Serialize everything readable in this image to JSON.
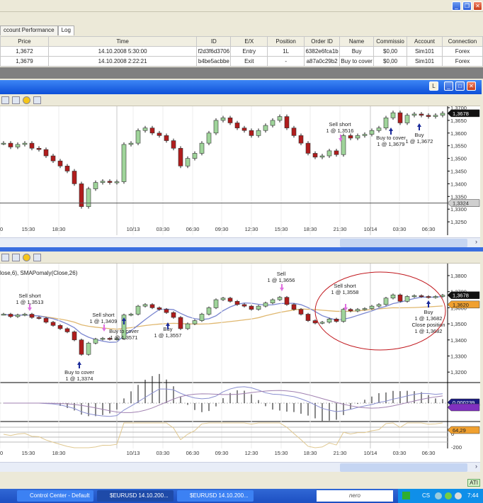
{
  "tabs": [
    "ccount Performance",
    "Log"
  ],
  "executions": {
    "columns": [
      "Price",
      "Time",
      "ID",
      "E/X",
      "Position",
      "Order ID",
      "Name",
      "Commissio",
      "Account",
      "Connection"
    ],
    "rows": [
      [
        "1,3672",
        "14.10.2008 5:30:00",
        "f2d3f6d3706",
        "Entry",
        "1L",
        "6382e6fca1b",
        "Buy",
        "$0,00",
        "Sim101",
        "Forex"
      ],
      [
        "1,3679",
        "14.10.2008 2:22:21",
        "b4be5acbbe",
        "Exit",
        "-",
        "a87a0c29b2",
        "Buy to cover",
        "$0,00",
        "Sim101",
        "Forex"
      ]
    ]
  },
  "chart_window": {
    "time_labels": [
      "30",
      "15:30",
      "18:30",
      "10/13",
      "03:30",
      "06:30",
      "09:30",
      "12:30",
      "15:30",
      "18:30",
      "21:30",
      "10/14",
      "03:30",
      "06:30"
    ],
    "close_prices": [
      1.356,
      1.3545,
      1.3555,
      1.356,
      1.354,
      1.3535,
      1.351,
      1.349,
      1.347,
      1.345,
      1.34,
      1.331,
      1.338,
      1.3405,
      1.341,
      1.3405,
      1.3408,
      1.3555,
      1.356,
      1.361,
      1.362,
      1.36,
      1.359,
      1.357,
      1.354,
      1.347,
      1.35,
      1.352,
      1.356,
      1.36,
      1.365,
      1.366,
      1.364,
      1.362,
      1.361,
      1.359,
      1.361,
      1.363,
      1.365,
      1.3665,
      1.362,
      1.359,
      1.356,
      1.352,
      1.3505,
      1.351,
      1.353,
      1.3515,
      1.359,
      1.358,
      1.359,
      1.3595,
      1.361,
      1.362,
      1.366,
      1.368,
      1.364,
      1.367,
      1.3675,
      1.367,
      1.3665,
      1.367,
      1.3678
    ],
    "top_panel": {
      "price_axis": [
        "1,3700",
        "1,3650",
        "1,3600",
        "1,3550",
        "1,3500",
        "1,3450",
        "1,3400",
        "1,3350",
        "1,3300",
        "1,3250"
      ],
      "last_price": "1,3678",
      "hline_price": "1,3324",
      "annotations": [
        {
          "line1": "Sell short",
          "line2": "1 @ 1,3516",
          "type": "sell"
        },
        {
          "line1": "Buy to cover",
          "line2": "1 @ 1,3679",
          "type": "buy"
        },
        {
          "line1": "Buy",
          "line2": "1 @ 1,3672",
          "type": "buy"
        }
      ]
    },
    "bottom_panel": {
      "indicator_label": "lose,6), SMAPomaly(Close,26)",
      "price_axis": [
        "1,3800",
        "1,3700",
        "1,3600",
        "1,3500",
        "1,3400",
        "1,3300",
        "1,3200"
      ],
      "last_price": "1,3678",
      "sma_value": "1,3620",
      "macd_value": "0,000239",
      "cci_value": "64,29",
      "cci_axis": [
        "0",
        "-200"
      ],
      "annotations": [
        {
          "line1": "Sell short",
          "line2": "1 @ 1,3513",
          "type": "sell"
        },
        {
          "line1": "Sell short",
          "line2": "1 @ 1,3409",
          "type": "sell"
        },
        {
          "line1": "Buy to cover",
          "line2": "1 @ 1,3571",
          "type": "buy"
        },
        {
          "line1": "Buy",
          "line2": "1 @ 1,3557",
          "type": "buy"
        },
        {
          "line1": "Buy to cover",
          "line2": "1 @ 1,3374",
          "type": "buy"
        },
        {
          "line1": "Sell",
          "line2": "1 @ 1,3656",
          "type": "sell"
        },
        {
          "line1": "Sell short",
          "line2": "1 @ 1,3558",
          "type": "sell"
        },
        {
          "line1": "Buy",
          "line2": "1 @ 1,3682",
          "line3": "Close position",
          "line4": "1 @ 1,3682",
          "type": "buy"
        }
      ]
    },
    "colors": {
      "up": "#9fd49a",
      "down": "#b01c1c",
      "sma_fast": "#7a86d0",
      "sma_slow": "#e0b870",
      "ellipse": "#c0161c",
      "buy_arrow": "#1a2a9a",
      "sell_arrow": "#e070e0"
    }
  },
  "status": {
    "ati": "ATI"
  },
  "taskbar": {
    "tasks": [
      "Control Center - Default",
      "$EURUSD  14.10.200...",
      "$EURUSD  14.10.200..."
    ],
    "nero": "nero",
    "lang": "CS",
    "clock": "7:44"
  }
}
